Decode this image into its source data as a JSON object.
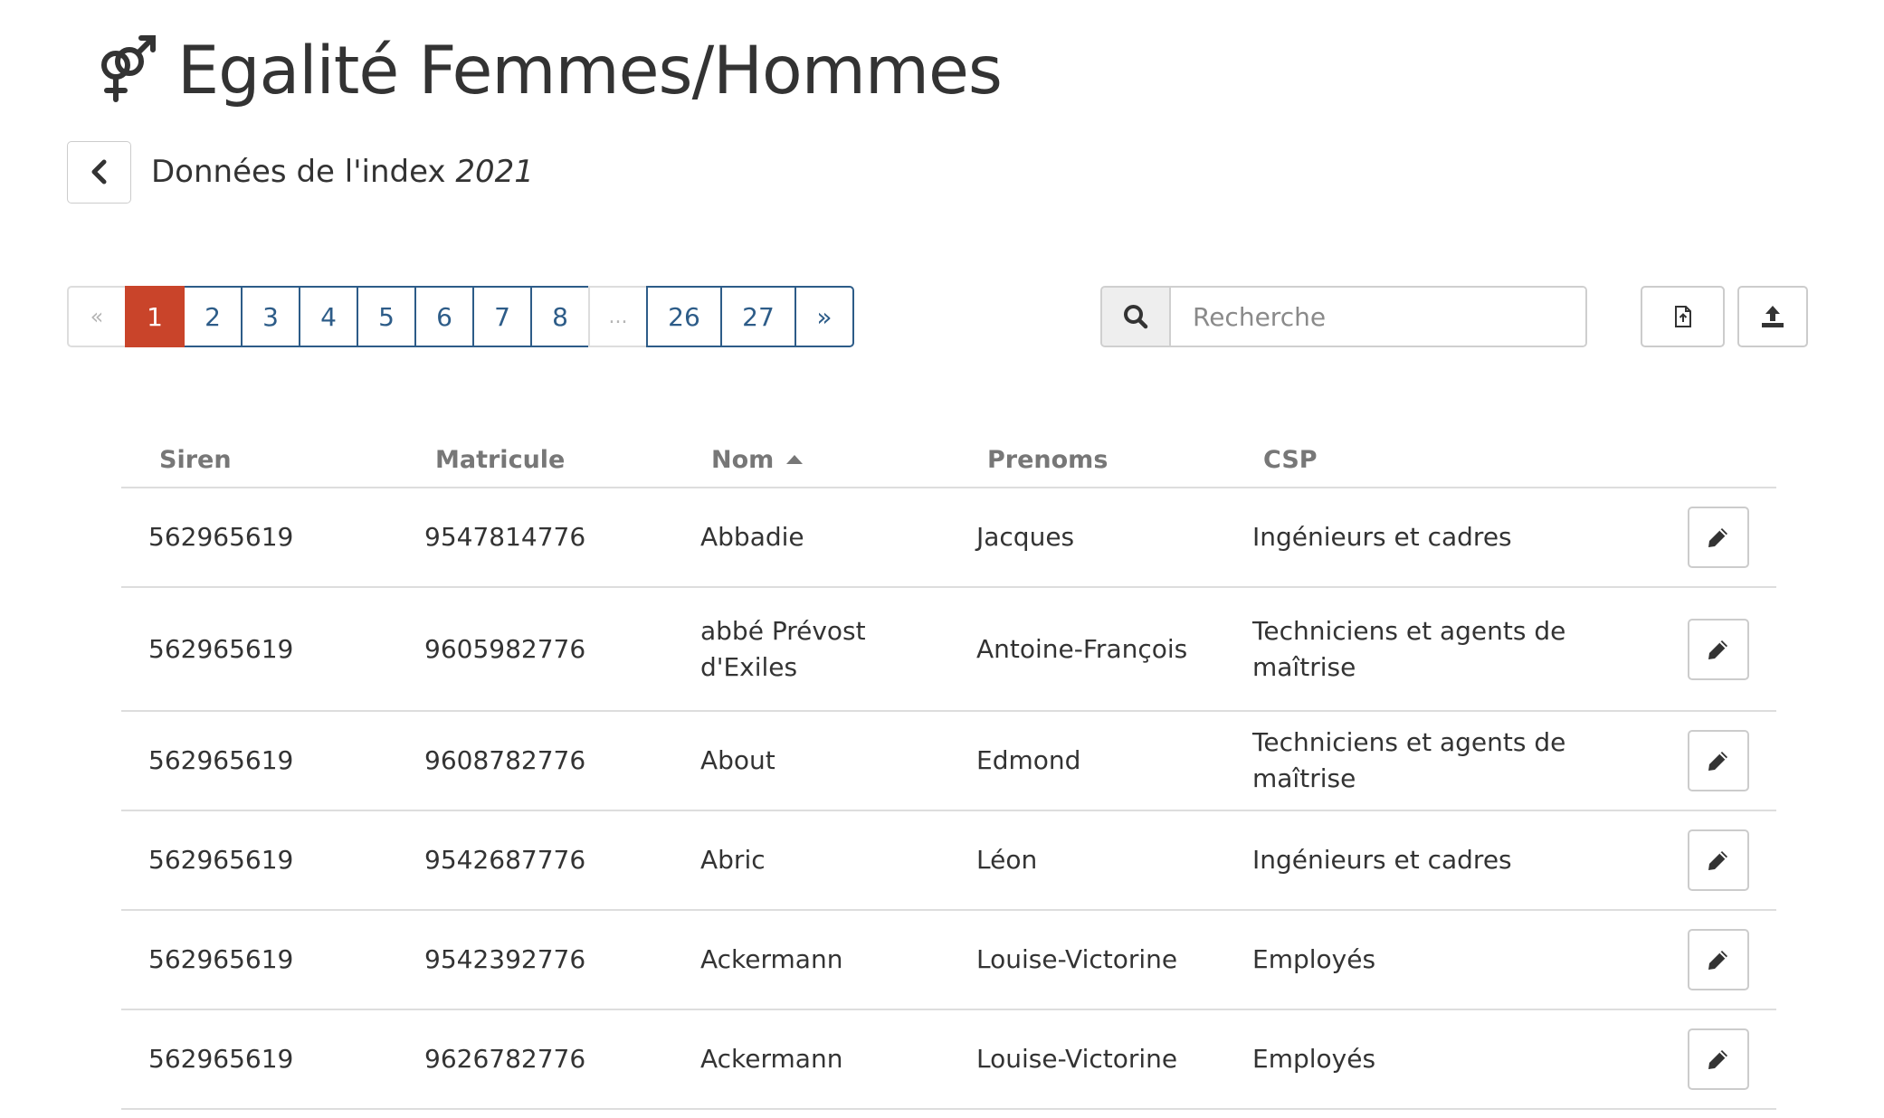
{
  "header": {
    "title": "Egalité Femmes/Hommes",
    "icon": "gender-icon"
  },
  "subheader": {
    "label": "Données de l'index",
    "year": "2021",
    "back_icon": "chevron-left-icon"
  },
  "pagination": {
    "first": "«",
    "pages": [
      "1",
      "2",
      "3",
      "4",
      "5",
      "6",
      "7",
      "8"
    ],
    "ellipsis": "...",
    "tail_pages": [
      "26",
      "27"
    ],
    "next": "»",
    "active": "1"
  },
  "search": {
    "placeholder": "Recherche",
    "value": "",
    "icon": "search-icon"
  },
  "toolbar": {
    "export_icon": "file-export-icon",
    "upload_icon": "upload-icon"
  },
  "table": {
    "columns": {
      "siren": "Siren",
      "matricule": "Matricule",
      "nom": "Nom",
      "prenoms": "Prenoms",
      "csp": "CSP"
    },
    "sorted_by": "Nom",
    "rows": [
      {
        "siren": "562965619",
        "matricule": "9547814776",
        "nom": "Abbadie",
        "prenoms": "Jacques",
        "csp": "Ingénieurs et cadres"
      },
      {
        "siren": "562965619",
        "matricule": "9605982776",
        "nom": "abbé Prévost d'Exiles",
        "prenoms": "Antoine-François",
        "csp": "Techniciens et agents de maîtrise"
      },
      {
        "siren": "562965619",
        "matricule": "9608782776",
        "nom": "About",
        "prenoms": "Edmond",
        "csp": "Techniciens et agents de maîtrise"
      },
      {
        "siren": "562965619",
        "matricule": "9542687776",
        "nom": "Abric",
        "prenoms": "Léon",
        "csp": "Ingénieurs et cadres"
      },
      {
        "siren": "562965619",
        "matricule": "9542392776",
        "nom": "Ackermann",
        "prenoms": "Louise-Victorine",
        "csp": "Employés"
      },
      {
        "siren": "562965619",
        "matricule": "9626782776",
        "nom": "Ackermann",
        "prenoms": "Louise-Victorine",
        "csp": "Employés"
      }
    ]
  },
  "colors": {
    "accent": "#c9442a",
    "link": "#2d5c88",
    "text": "#333333",
    "muted": "#777777"
  }
}
